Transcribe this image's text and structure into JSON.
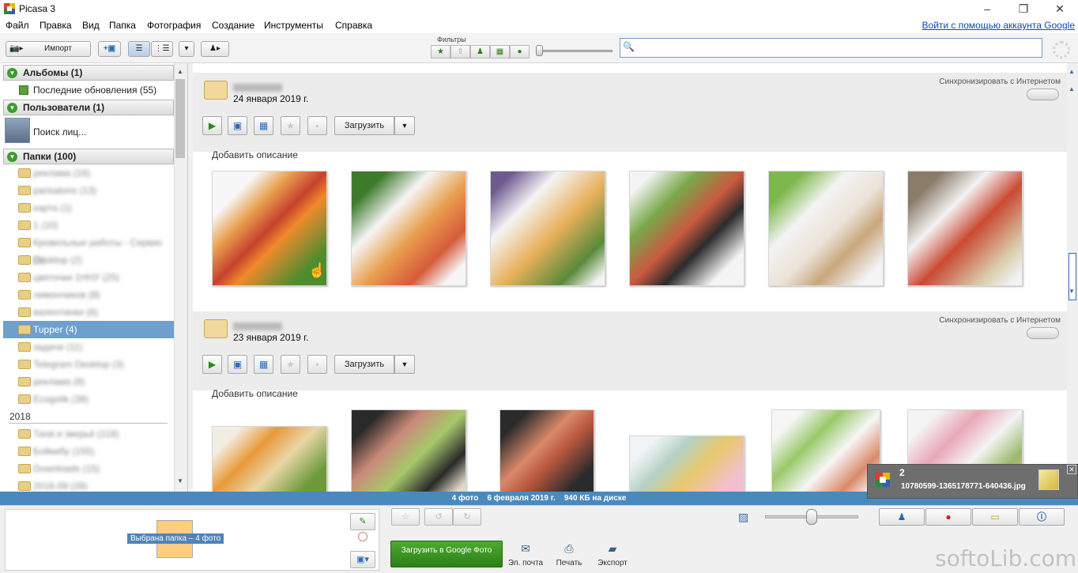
{
  "app": {
    "title": "Picasa 3",
    "window_controls": [
      "–",
      "❐",
      "✕"
    ]
  },
  "menu": {
    "items": [
      "Файл",
      "Правка",
      "Вид",
      "Папка",
      "Фотография",
      "Создание",
      "Инструменты",
      "Справка"
    ],
    "google_login": "Войти с помощью аккаунта Google"
  },
  "toolbar": {
    "import_label": "Импорт",
    "filters_label": "Фильтры"
  },
  "search": {
    "placeholder": ""
  },
  "sidebar": {
    "albums_header": "Альбомы (1)",
    "recent_updates": "Последние обновления (55)",
    "people_header": "Пользователи (1)",
    "face_search": "Поиск лиц...",
    "folders_header": "Папки (100)",
    "folders": [
      "реклама (16)",
      "parisatons (13)",
      "карта (1)",
      "1 (10)",
      "Кровельные работы - Сервис (1)",
      "Desktop (2)",
      "цветочки 1ННУ (25)",
      "лимончиков (8)",
      "валентинки (6)",
      "Tupper (4)",
      "задачи (11)",
      "Telegram Desktop (3)",
      "реклама (8)",
      "Ecogolik (38)"
    ],
    "selected_folder": "Tupper (4)",
    "year_label": "2018",
    "folders_2018": [
      "Таня и зверьё (118)",
      "Бойкибу (155)",
      "Downloads (15)",
      "2016-09 (28)"
    ]
  },
  "albums": [
    {
      "date": "24 января 2019 г.",
      "sync_label": "Синхронизировать с Интернетом",
      "upload_label": "Загрузить",
      "description_prompt": "Добавить описание"
    },
    {
      "date": "23 января 2019 г.",
      "sync_label": "Синхронизировать с Интернетом",
      "upload_label": "Загрузить",
      "description_prompt": "Добавить описание"
    }
  ],
  "status": {
    "count": "4 фото",
    "date": "6 февраля 2019 г.",
    "size": "940 КБ на диске"
  },
  "tray": {
    "tooltip": "Выбрана папка – 4 фото",
    "upload_google": "Загрузить в Google Фото",
    "email": "Эл. почта",
    "print": "Печать",
    "export": "Экспорт"
  },
  "notification": {
    "count": "2",
    "filename": "10780599-1365178771-640436.jpg"
  },
  "watermark": "softoLib.com",
  "colors": {
    "status_bar": "#4a89bd",
    "selected_row": "#6f9fcf",
    "google_button": "#3a9a22"
  }
}
